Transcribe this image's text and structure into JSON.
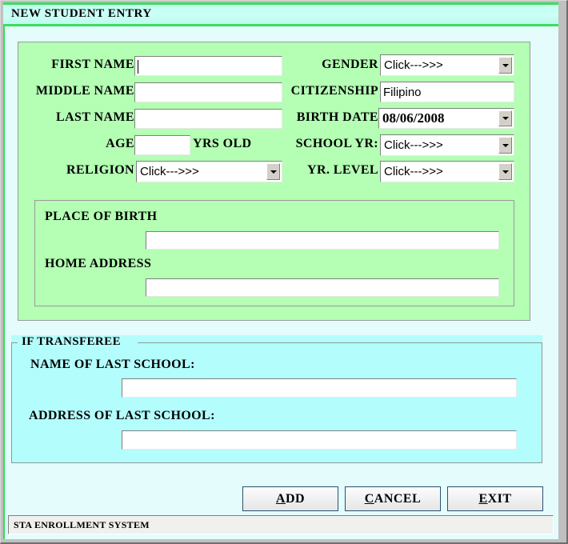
{
  "window": {
    "title": "NEW STUDENT ENTRY"
  },
  "form": {
    "left_column": {
      "first_name": {
        "label": "FIRST NAME",
        "value": "",
        "focused": true
      },
      "middle_name": {
        "label": "MIDDLE NAME",
        "value": ""
      },
      "last_name": {
        "label": "LAST NAME",
        "value": ""
      },
      "age": {
        "label": "AGE",
        "value": "",
        "suffix": "YRS OLD"
      },
      "religion": {
        "label": "RELIGION",
        "value": "Click--->>>",
        "control": "combobox"
      }
    },
    "right_column": {
      "gender": {
        "label": "GENDER",
        "value": "Click--->>>",
        "control": "combobox"
      },
      "citizenship": {
        "label": "CITIZENSHIP",
        "value": "Filipino",
        "control": "textbox"
      },
      "birth_date": {
        "label": "BIRTH DATE",
        "value": "08/06/2008",
        "control": "datepicker"
      },
      "school_yr": {
        "label": "SCHOOL YR:",
        "value": "Click--->>>",
        "control": "combobox"
      },
      "yr_level": {
        "label": "YR. LEVEL",
        "value": "Click--->>>",
        "control": "combobox"
      }
    },
    "address_panel": {
      "place_of_birth": {
        "label": "PLACE OF BIRTH",
        "value": ""
      },
      "home_address": {
        "label": "HOME ADDRESS",
        "value": ""
      }
    },
    "transferee": {
      "legend": "IF TRANSFEREE",
      "name_of_last_school": {
        "label": "NAME OF LAST SCHOOL:",
        "value": ""
      },
      "address_of_last_school": {
        "label": "ADDRESS OF LAST SCHOOL:",
        "value": ""
      }
    }
  },
  "buttons": {
    "add": {
      "accel": "A",
      "rest": "DD"
    },
    "cancel": {
      "accel": "C",
      "rest": "ANCEL"
    },
    "exit": {
      "accel": "E",
      "rest": "XIT"
    }
  },
  "statusbar": {
    "text": "STA ENROLLMENT SYSTEM"
  },
  "colors": {
    "title_bar": "#c6fff1",
    "title_border_green": "#3ddc5e",
    "panel_green": "#b4ffb4",
    "panel_cyan": "#b4fdfd",
    "dialog_background": "#e4fcfc",
    "button_border": "#2b5070",
    "window_frame": "#c0c0c0",
    "status_bar": "#f0f0ee"
  }
}
